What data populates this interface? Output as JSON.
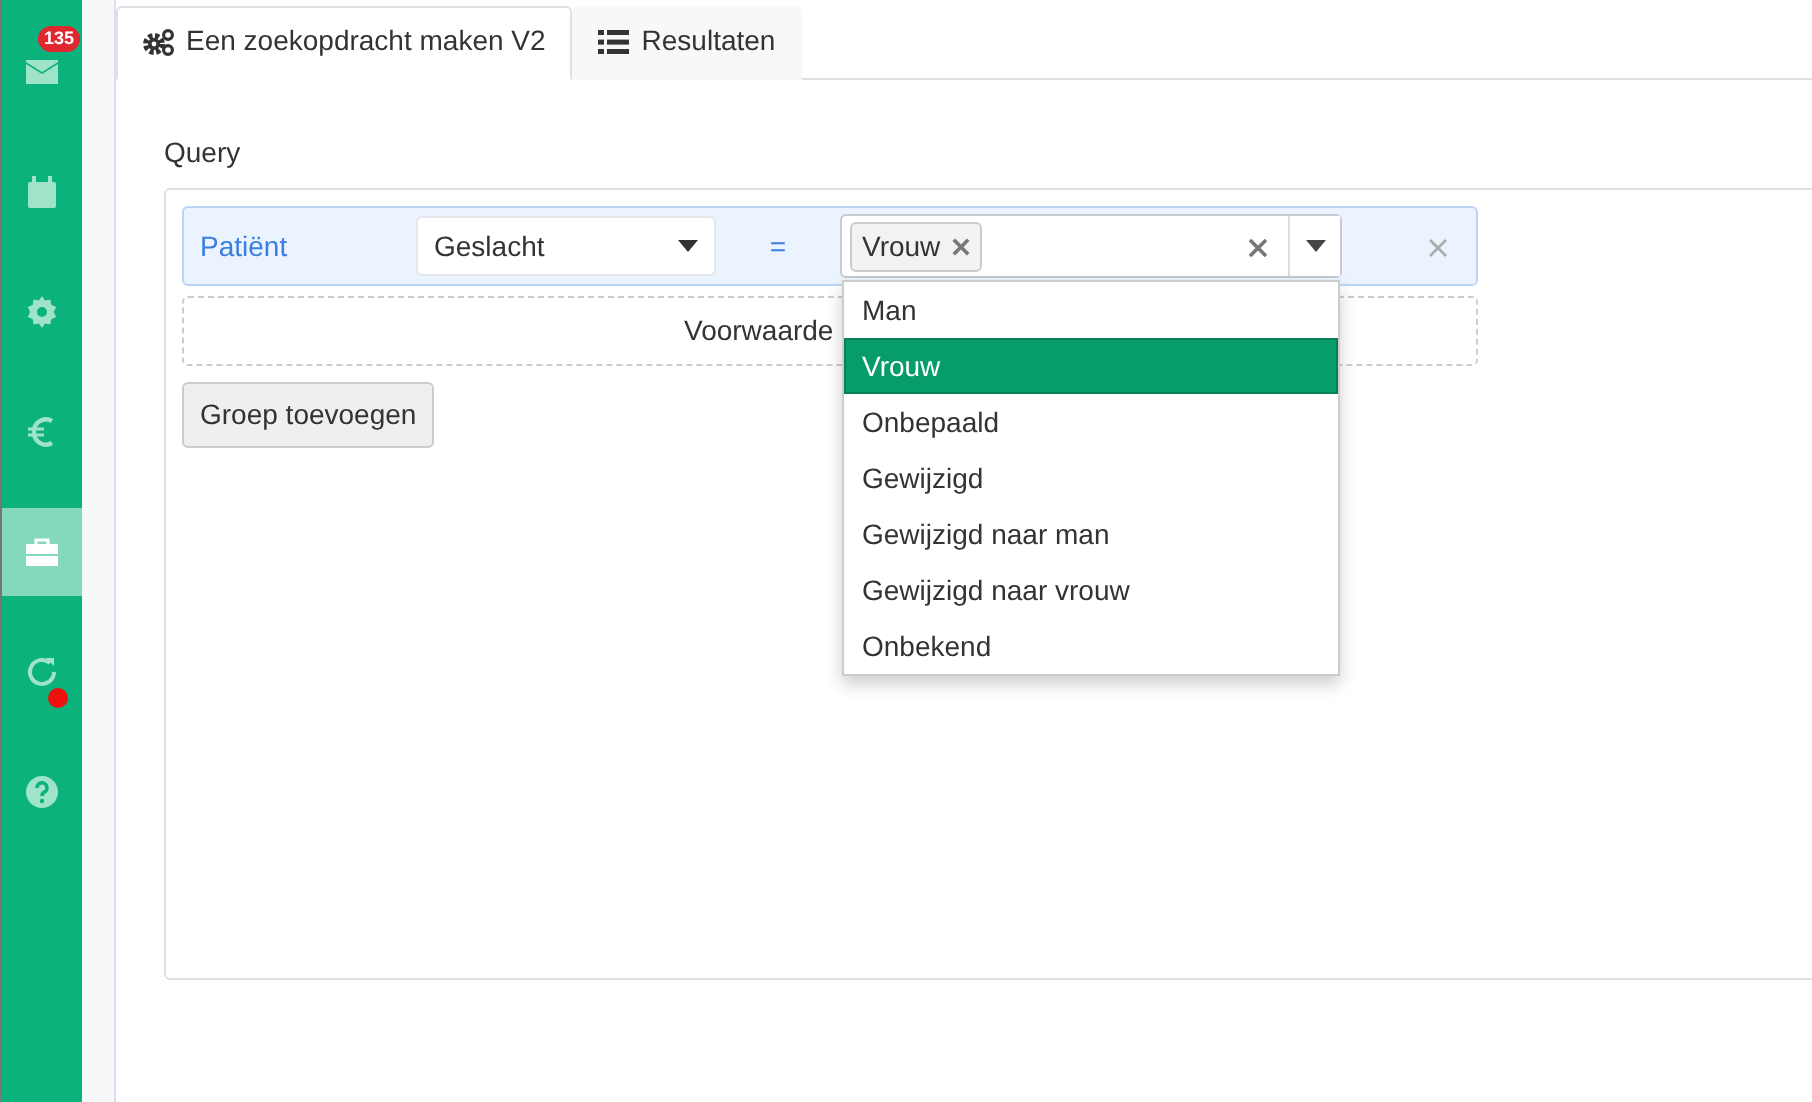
{
  "sidebar": {
    "items": [
      {
        "selected": false,
        "badge": "135",
        "alert": false
      },
      {
        "selected": false,
        "alert": false
      },
      {
        "selected": false,
        "alert": false
      },
      {
        "selected": false,
        "alert": false
      },
      {
        "selected": true,
        "alert": false
      },
      {
        "selected": false,
        "alert": true
      },
      {
        "selected": false,
        "alert": false
      }
    ]
  },
  "tabs": [
    {
      "label": "Een zoekopdracht maken V2",
      "selected": true
    },
    {
      "label": "Resultaten",
      "selected": false
    }
  ],
  "query": {
    "label": "Query",
    "rule": {
      "entity": "Patiënt",
      "field": "Geslacht",
      "operator": "=",
      "tags": [
        "Vrouw"
      ]
    },
    "add_condition": "Voorwaarde",
    "add_group": "Groep toevoegen"
  },
  "dropdown": {
    "options": [
      {
        "label": "Man",
        "selected": false
      },
      {
        "label": "Vrouw",
        "selected": true
      },
      {
        "label": "Onbepaald",
        "selected": false
      },
      {
        "label": "Gewijzigd",
        "selected": false
      },
      {
        "label": "Gewijzigd naar man",
        "selected": false
      },
      {
        "label": "Gewijzigd naar vrouw",
        "selected": false
      },
      {
        "label": "Onbekend",
        "selected": false
      }
    ]
  }
}
